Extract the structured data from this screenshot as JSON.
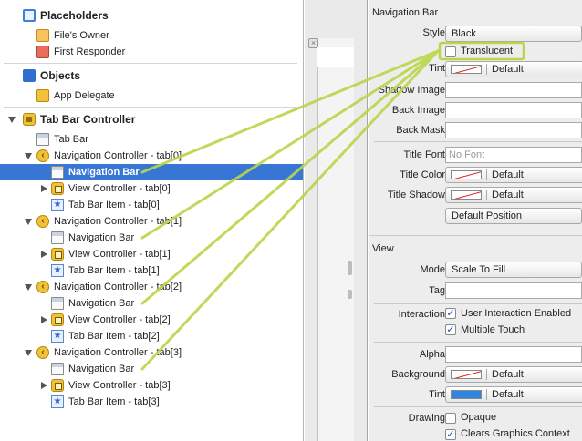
{
  "outline": {
    "placeholders_label": "Placeholders",
    "files_owner": "File's Owner",
    "first_responder": "First Responder",
    "objects_label": "Objects",
    "app_delegate": "App Delegate",
    "tab_bar_controller": "Tab Bar Controller",
    "tab_bar": "Tab Bar",
    "groups": [
      {
        "nav_controller": "Navigation Controller - tab[0]",
        "nav_bar": "Navigation Bar",
        "view_controller": "View Controller - tab[0]",
        "tab_bar_item": "Tab Bar Item - tab[0]"
      },
      {
        "nav_controller": "Navigation Controller - tab[1]",
        "nav_bar": "Navigation Bar",
        "view_controller": "View Controller - tab[1]",
        "tab_bar_item": "Tab Bar Item - tab[1]"
      },
      {
        "nav_controller": "Navigation Controller - tab[2]",
        "nav_bar": "Navigation Bar",
        "view_controller": "View Controller - tab[2]",
        "tab_bar_item": "Tab Bar Item - tab[2]"
      },
      {
        "nav_controller": "Navigation Controller - tab[3]",
        "nav_bar": "Navigation Bar",
        "view_controller": "View Controller - tab[3]",
        "tab_bar_item": "Tab Bar Item - tab[3]"
      }
    ]
  },
  "inspector": {
    "navbar_section": "Navigation Bar",
    "style_label": "Style",
    "style_value": "Black",
    "translucent_label": "Translucent",
    "translucent_checked": false,
    "tint_label": "Tint",
    "tint_value": "Default",
    "shadow_image_label": "Shadow Image",
    "back_image_label": "Back Image",
    "back_mask_label": "Back Mask",
    "title_font_label": "Title Font",
    "title_font_placeholder": "No Font",
    "title_color_label": "Title Color",
    "title_color_value": "Default",
    "title_shadow_label": "Title Shadow",
    "title_shadow_value": "Default",
    "default_position": "Default Position",
    "view_section": "View",
    "mode_label": "Mode",
    "mode_value": "Scale To Fill",
    "tag_label": "Tag",
    "interaction_label": "Interaction",
    "user_interaction_label": "User Interaction Enabled",
    "user_interaction_checked": true,
    "multiple_touch_label": "Multiple Touch",
    "multiple_touch_checked": true,
    "alpha_label": "Alpha",
    "background_label": "Background",
    "background_value": "Default",
    "view_tint_label": "Tint",
    "view_tint_value": "Default",
    "view_tint_color": "#2f86e0",
    "drawing_label": "Drawing",
    "opaque_label": "Opaque",
    "opaque_checked": false,
    "clears_label": "Clears Graphics Context",
    "clears_checked": true
  },
  "colors": {
    "selection": "#3876d5",
    "connection_line": "#b9d64a",
    "highlight_box": "#b9d64a"
  }
}
